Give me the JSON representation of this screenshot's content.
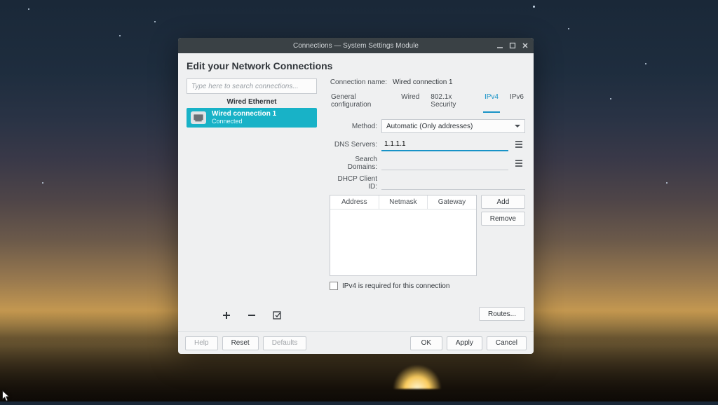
{
  "window": {
    "title": "Connections — System Settings Module"
  },
  "page": {
    "heading": "Edit your Network Connections"
  },
  "sidebar": {
    "search_placeholder": "Type here to search connections...",
    "group_label": "Wired Ethernet",
    "connection": {
      "name": "Wired connection 1",
      "status": "Connected"
    }
  },
  "details": {
    "connection_name_label": "Connection name:",
    "connection_name_value": "Wired connection 1",
    "tabs": {
      "general": "General configuration",
      "wired": "Wired",
      "security": "802.1x Security",
      "ipv4": "IPv4",
      "ipv6": "IPv6"
    },
    "ipv4": {
      "method_label": "Method:",
      "method_value": "Automatic (Only addresses)",
      "dns_label": "DNS Servers:",
      "dns_value": "1.1.1.1",
      "search_label": "Search Domains:",
      "search_value": "",
      "dhcp_label": "DHCP Client ID:",
      "dhcp_value": "",
      "table": {
        "col_address": "Address",
        "col_netmask": "Netmask",
        "col_gateway": "Gateway"
      },
      "add_btn": "Add",
      "remove_btn": "Remove",
      "required_label": "IPv4 is required for this connection",
      "required_checked": false,
      "routes_btn": "Routes..."
    }
  },
  "footer": {
    "help": "Help",
    "reset": "Reset",
    "defaults": "Defaults",
    "ok": "OK",
    "apply": "Apply",
    "cancel": "Cancel"
  }
}
